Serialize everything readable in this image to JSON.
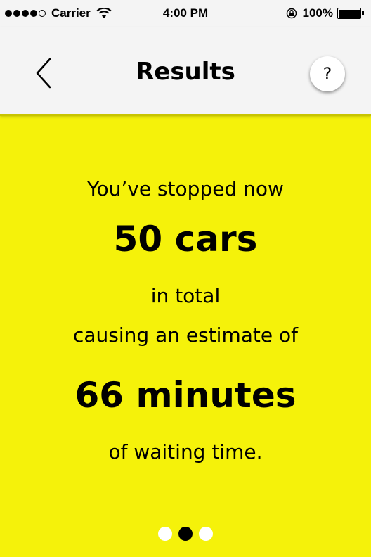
{
  "status_bar": {
    "carrier": "Carrier",
    "time": "4:00 PM",
    "battery": "100%"
  },
  "nav": {
    "title": "Results",
    "help_label": "?"
  },
  "results": {
    "line1": "You’ve stopped now",
    "cars": "50 cars",
    "line3": "in total",
    "line4": "causing an estimate of",
    "minutes": "66 minutes",
    "line6": "of waiting time."
  },
  "pager": {
    "pages": 3,
    "current_page": 2
  },
  "colors": {
    "background": "#f5f20a",
    "nav_background": "#f4f4f4"
  },
  "icons": {
    "back": "chevron-left-icon",
    "signal": "signal-dots-icon",
    "wifi": "wifi-icon",
    "rotation_lock": "rotation-lock-icon",
    "battery": "battery-icon"
  }
}
